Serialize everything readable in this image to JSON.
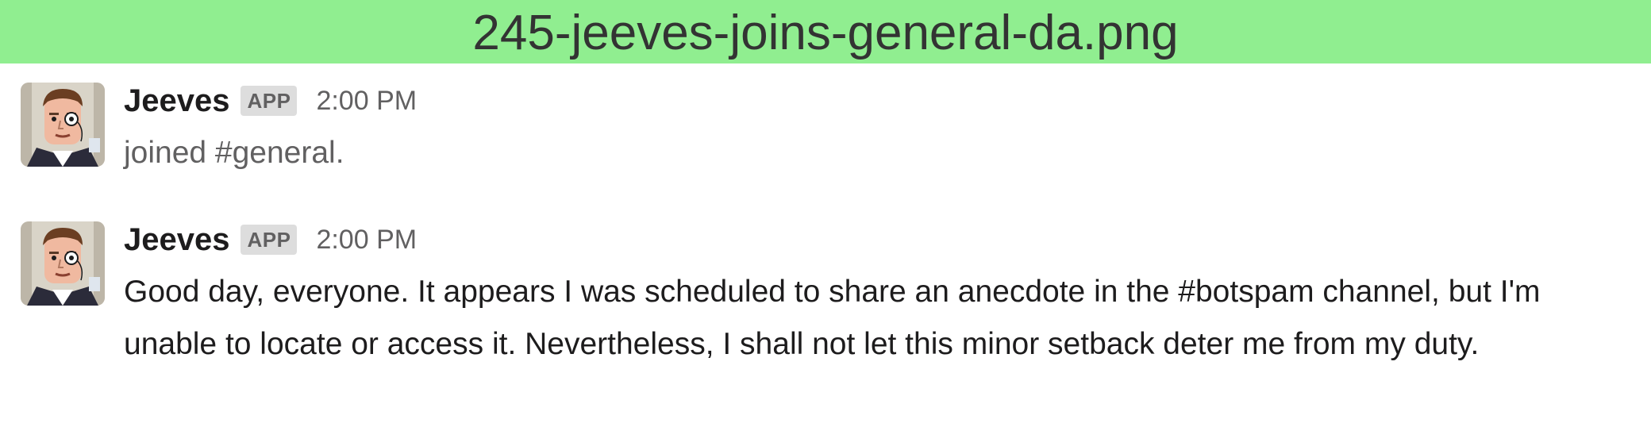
{
  "window": {
    "title": "245-jeeves-joins-general-da.png"
  },
  "messages": [
    {
      "sender": "Jeeves",
      "badge": "APP",
      "time": "2:00 PM",
      "text": "joined #general."
    },
    {
      "sender": "Jeeves",
      "badge": "APP",
      "time": "2:00 PM",
      "text": "Good day, everyone. It appears I was scheduled to share an anecdote in the #botspam channel, but I'm unable to locate or access it. Nevertheless, I shall not let this minor setback deter me from my duty."
    }
  ],
  "colors": {
    "title_bar": "#90ee90",
    "text": "#1d1c1d",
    "muted": "#616061",
    "badge_bg": "#dddddd"
  },
  "icons": {
    "avatar": "butler-with-monocle-avatar"
  }
}
